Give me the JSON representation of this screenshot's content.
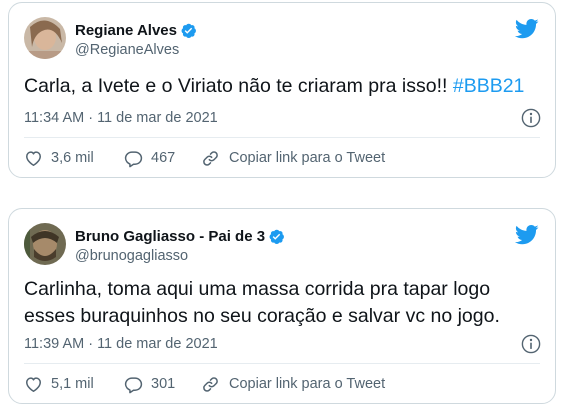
{
  "colors": {
    "accent": "#1d9bf0",
    "text_primary": "#0f1419",
    "text_secondary": "#536471",
    "border": "#cfd9de"
  },
  "tweets": [
    {
      "display_name": "Regiane Alves",
      "handle": "@RegianeAlves",
      "verified": true,
      "text": "Carla, a Ivete e o Viriato não te criaram pra isso!!",
      "hashtag": "#BBB21",
      "timestamp": "11:34 AM · 11 de mar de 2021",
      "likes": "3,6 mil",
      "replies": "467",
      "share_label": "Copiar link para o Tweet",
      "icons": [
        "avatar",
        "verified-badge-icon",
        "twitter-bird-icon",
        "info-icon",
        "heart-icon",
        "reply-icon",
        "link-icon"
      ]
    },
    {
      "display_name": "Bruno Gagliasso - Pai de 3",
      "handle": "@brunogagliasso",
      "verified": true,
      "text_line1": "Carlinha, toma aqui uma massa corrida pra tapar logo",
      "text_line2": "esses buraquinhos no seu coração e salvar vc no jogo.",
      "timestamp": "11:39 AM · 11 de mar de 2021",
      "likes": "5,1 mil",
      "replies": "301",
      "share_label": "Copiar link para o Tweet",
      "icons": [
        "avatar",
        "verified-badge-icon",
        "twitter-bird-icon",
        "info-icon",
        "heart-icon",
        "reply-icon",
        "link-icon"
      ]
    }
  ]
}
